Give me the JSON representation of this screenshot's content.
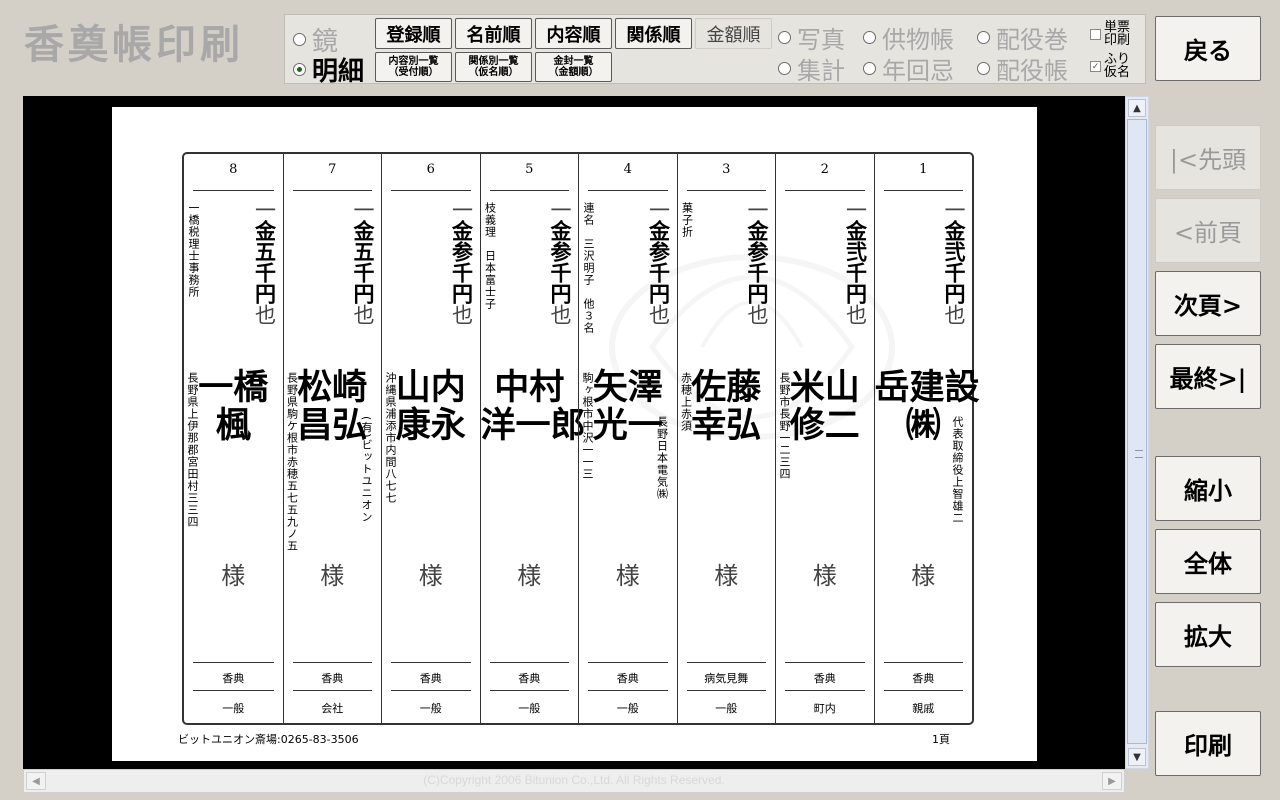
{
  "app": {
    "title": "香奠帳印刷"
  },
  "toolbar": {
    "mode_mirror": "鏡",
    "mode_detail": "明細",
    "sort_buttons": [
      "登録順",
      "名前順",
      "内容順",
      "関係順",
      "金額順"
    ],
    "sub_buttons": [
      "内容別一覧\n（受付順）",
      "関係別一覧\n（仮名順）",
      "金封一覧\n（金額順）"
    ],
    "options_row1": [
      "写真",
      "供物帳",
      "配役巻"
    ],
    "options_row2": [
      "集計",
      "年回忌",
      "配役帳"
    ],
    "check1_label": "単票\n印刷",
    "check2_label": "ふり\n仮名",
    "check1_checked": false,
    "check2_checked": true
  },
  "side": {
    "back": "戻る",
    "first": "|<先頭",
    "prev": "<前頁",
    "next": "次頁>",
    "last": "最終>|",
    "zoom_out": "縮小",
    "fit": "全体",
    "zoom_in": "拡大",
    "print": "印刷"
  },
  "register": {
    "entries": [
      {
        "no": "8",
        "amount": "金五千円",
        "name": "一橋\n楓",
        "honorific": "様",
        "address": "長野県上伊那郡宮田村三三四",
        "note": "一橋税理士事務所",
        "sub": "",
        "category": "香典",
        "relation": "一般"
      },
      {
        "no": "7",
        "amount": "金五千円",
        "name": "松崎\n昌弘",
        "honorific": "様",
        "address": "長野県駒ケ根市赤穂五七五九ノ五",
        "note": "",
        "sub": "(有)ビットユニオン",
        "category": "香典",
        "relation": "会社"
      },
      {
        "no": "6",
        "amount": "金参千円",
        "name": "山内\n康永",
        "honorific": "様",
        "address": "沖縄県浦添市内間八七七",
        "note": "",
        "sub": "",
        "category": "香典",
        "relation": "一般"
      },
      {
        "no": "5",
        "amount": "金参千円",
        "name": "中村\n洋一郎",
        "honorific": "様",
        "address": "",
        "note": "枝義理　日本富士子",
        "sub": "",
        "category": "香典",
        "relation": "一般"
      },
      {
        "no": "4",
        "amount": "金参千円",
        "name": "矢澤\n光一",
        "honorific": "様",
        "address": "駒ヶ根市中沢一一三",
        "note": "連名　三沢明子　他３名",
        "sub": "長野日本電気㈱",
        "category": "香典",
        "relation": "一般"
      },
      {
        "no": "3",
        "amount": "金参千円",
        "name": "佐藤\n幸弘",
        "honorific": "様",
        "address": "赤穂上赤須",
        "note": "菓子折",
        "sub": "",
        "category": "病気見舞",
        "relation": "一般"
      },
      {
        "no": "2",
        "amount": "金弐千円",
        "name": "米山\n修二",
        "honorific": "様",
        "address": "長野市長野一二三四",
        "note": "",
        "sub": "",
        "category": "香典",
        "relation": "町内"
      },
      {
        "no": "1",
        "amount": "金弐千円",
        "name": "岳建設\n㈱",
        "honorific": "様",
        "address": "",
        "note": "",
        "sub": "代表取締役上智雄二",
        "category": "香典",
        "relation": "親戚"
      }
    ],
    "unit_prefix": "一",
    "unit_suffix": "也",
    "footer_left": "ビットユニオン斎場:0265-83-3506",
    "footer_right": "1頁"
  },
  "copyright": "(C)Copyright 2006 Bitunion Co.,Ltd. All Rights Reserved."
}
